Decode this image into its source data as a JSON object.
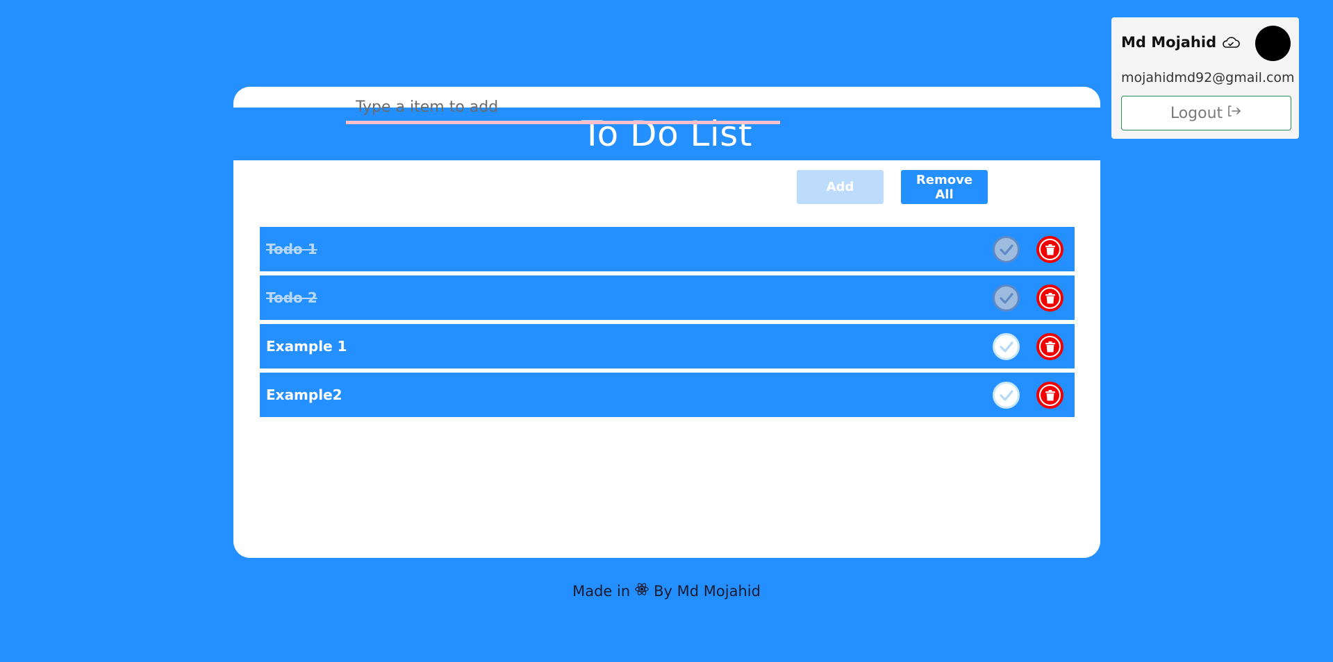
{
  "app": {
    "title": "To Do List"
  },
  "input": {
    "placeholder": "Type a item to add",
    "value": ""
  },
  "buttons": {
    "add_label": "Add",
    "remove_all_label": "Remove All"
  },
  "todos": [
    {
      "text": "Todo 1",
      "completed": true
    },
    {
      "text": "Todo 2",
      "completed": true
    },
    {
      "text": "Example 1",
      "completed": false
    },
    {
      "text": "Example2",
      "completed": false
    }
  ],
  "footer": {
    "made_in": "Made in",
    "icon": "react-atom-icon",
    "by": "By Md Mojahid"
  },
  "user": {
    "name": "Md Mojahid",
    "email": "mojahidmd92@gmail.com",
    "logout_label": "Logout",
    "sync_icon": "cloud-icon",
    "logout_icon": "logout-arrow-icon"
  },
  "colors": {
    "background": "#2490FF",
    "card": "#FFFFFF",
    "input_underline": "#FFC0CB",
    "add_button": "#BDDCFB",
    "delete": "#F10000",
    "logout_border": "#2E8B57"
  }
}
